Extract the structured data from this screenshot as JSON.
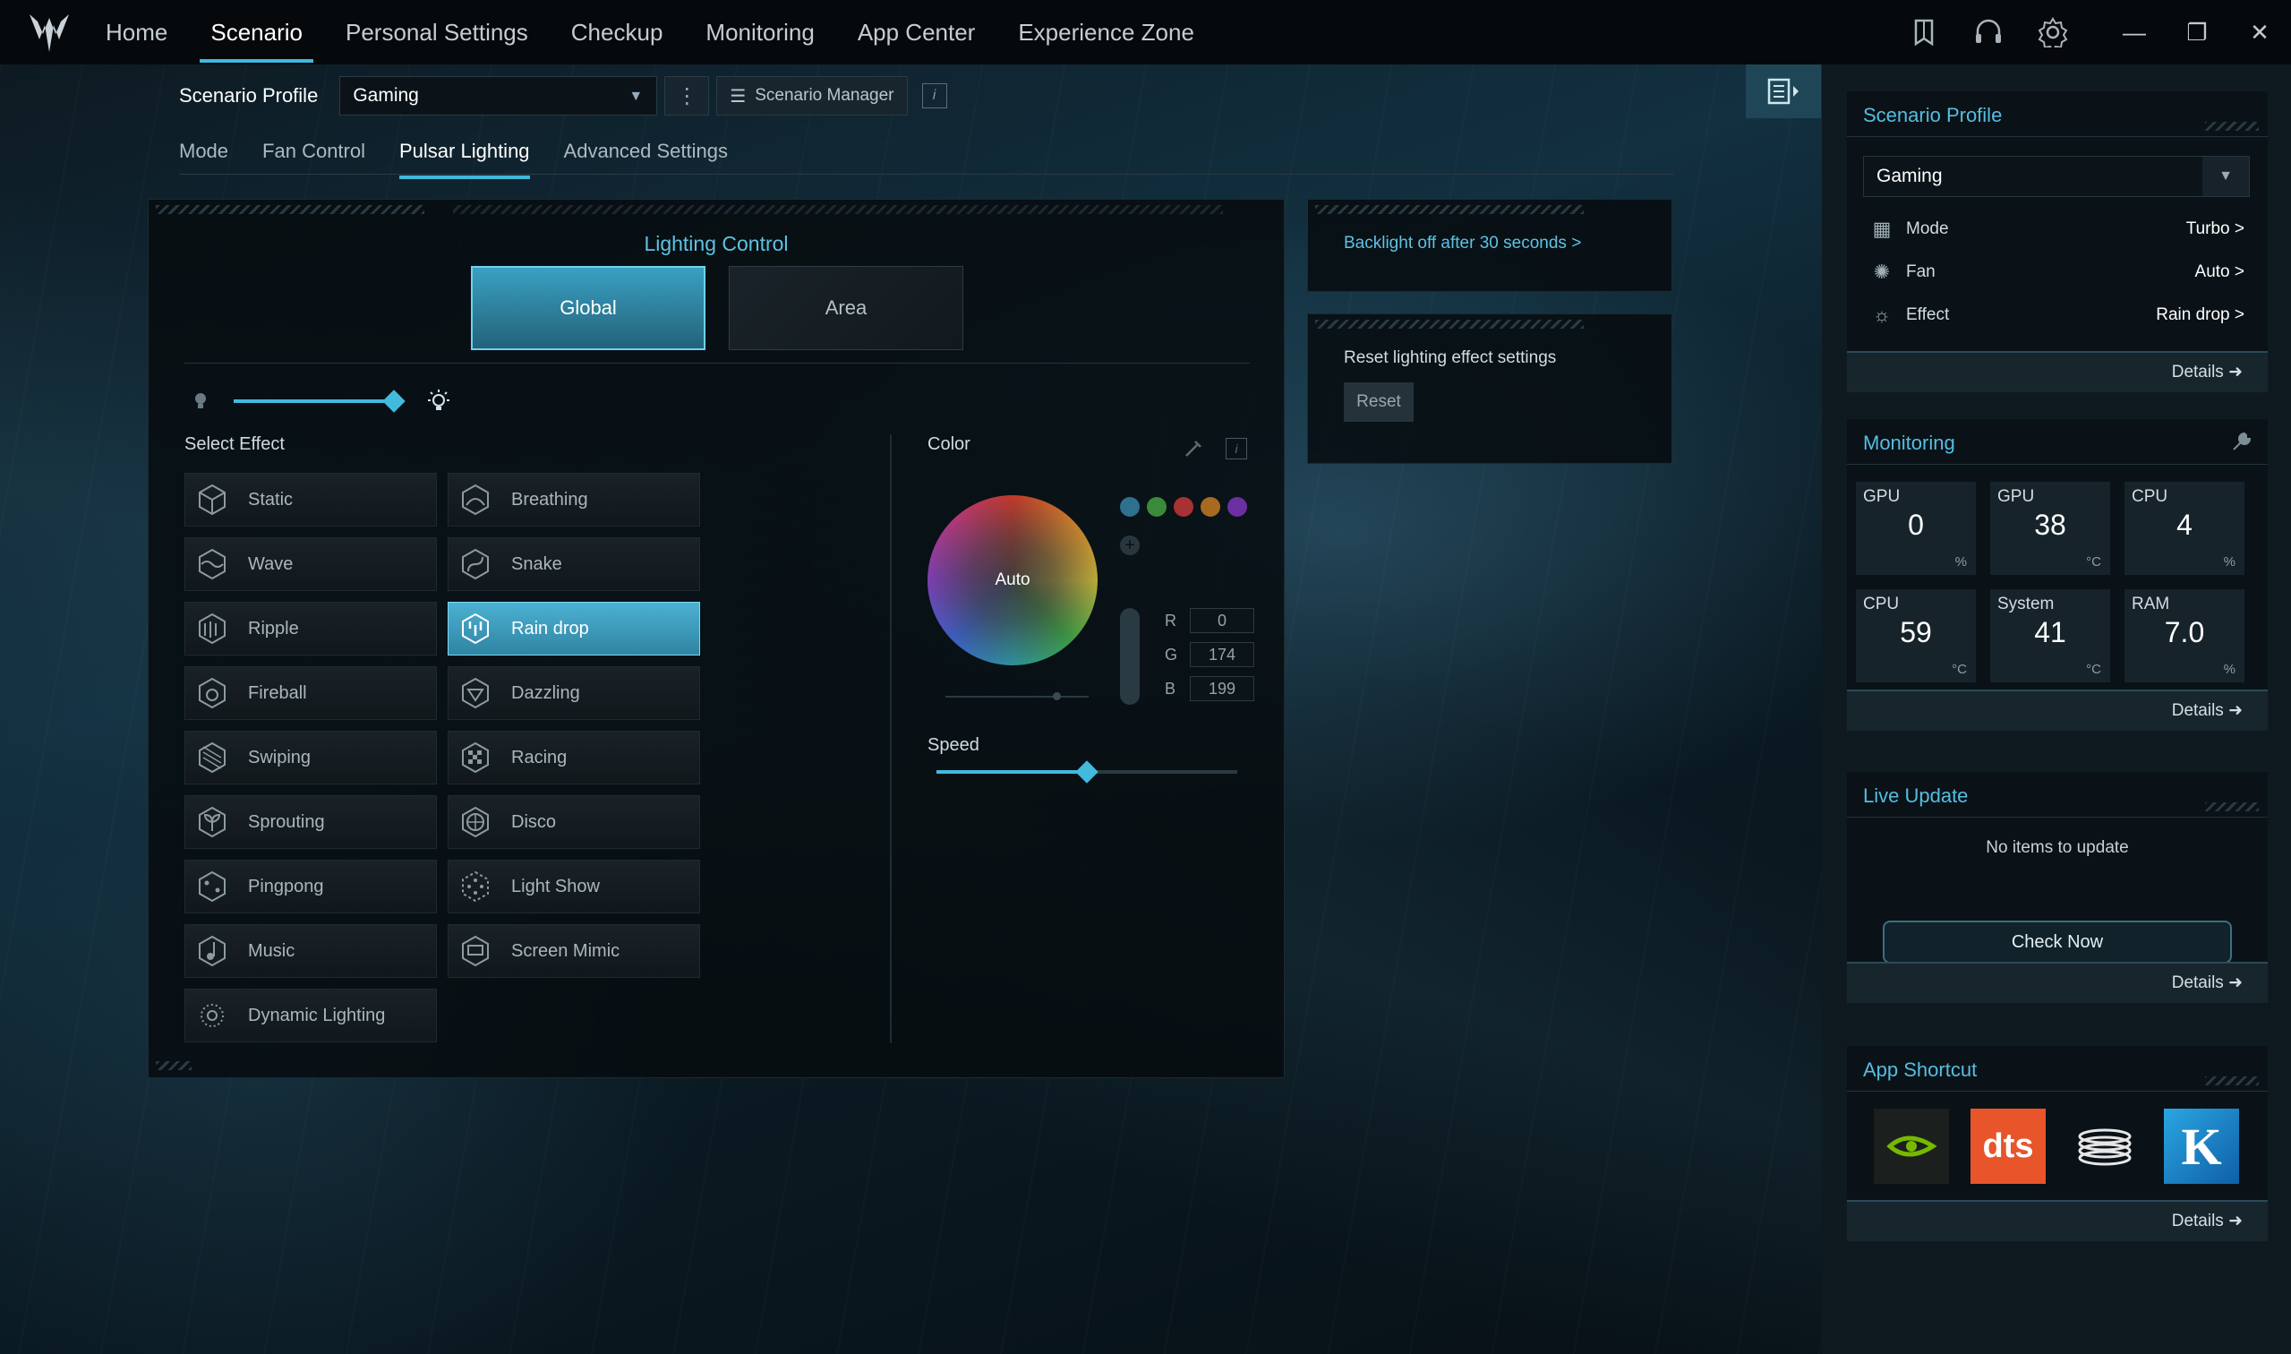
{
  "nav": {
    "items": [
      "Home",
      "Scenario",
      "Personal Settings",
      "Checkup",
      "Monitoring",
      "App Center",
      "Experience Zone"
    ],
    "active_index": 1
  },
  "toolbar_icons": [
    "bookmark-icon",
    "headset-icon",
    "gear-icon"
  ],
  "window_controls": [
    "—",
    "❐",
    "✕"
  ],
  "profile": {
    "label": "Scenario Profile",
    "value": "Gaming",
    "manager_label": "Scenario Manager",
    "info": "i"
  },
  "tabs": [
    "Mode",
    "Fan Control",
    "Pulsar Lighting",
    "Advanced Settings"
  ],
  "active_tab": 2,
  "lighting": {
    "title": "Lighting Control",
    "global_label": "Global",
    "area_label": "Area",
    "brightness_fraction": 0.97,
    "select_effect_label": "Select Effect",
    "effects": [
      [
        "Static",
        "Breathing"
      ],
      [
        "Wave",
        "Snake"
      ],
      [
        "Ripple",
        "Rain drop"
      ],
      [
        "Fireball",
        "Dazzling"
      ],
      [
        "Swiping",
        "Racing"
      ],
      [
        "Sprouting",
        "Disco"
      ],
      [
        "Pingpong",
        "Light Show"
      ],
      [
        "Music",
        "Screen Mimic"
      ],
      [
        "Dynamic Lighting"
      ]
    ],
    "active_effect": "Rain drop",
    "color_label": "Color",
    "color_mode": "Auto",
    "swatches": [
      "#2f6f8f",
      "#3a8a3a",
      "#a83232",
      "#a86a1f",
      "#6a2fa0"
    ],
    "rgb": {
      "r_label": "R",
      "r": "0",
      "g_label": "G",
      "g": "174",
      "b_label": "B",
      "b": "199"
    },
    "speed_label": "Speed",
    "speed_fraction": 0.5
  },
  "backlight": {
    "link": "Backlight off after 30 seconds >"
  },
  "reset_card": {
    "text": "Reset lighting effect settings",
    "button": "Reset"
  },
  "sidebar": {
    "scenario": {
      "title": "Scenario Profile",
      "value": "Gaming",
      "rows": [
        {
          "label": "Mode",
          "value": "Turbo >"
        },
        {
          "label": "Fan",
          "value": "Auto >"
        },
        {
          "label": "Effect",
          "value": "Rain drop >"
        }
      ],
      "details": "Details ➜"
    },
    "monitoring": {
      "title": "Monitoring",
      "cells": [
        {
          "label": "GPU",
          "value": "0",
          "unit": "%"
        },
        {
          "label": "GPU",
          "value": "38",
          "unit": "°C"
        },
        {
          "label": "CPU",
          "value": "4",
          "unit": "%"
        },
        {
          "label": "CPU",
          "value": "59",
          "unit": "°C"
        },
        {
          "label": "System",
          "value": "41",
          "unit": "°C"
        },
        {
          "label": "RAM",
          "value": "7.0",
          "unit": "%"
        }
      ],
      "details": "Details ➜"
    },
    "live_update": {
      "title": "Live Update",
      "message": "No items to update",
      "button": "Check Now",
      "details": "Details ➜"
    },
    "app_shortcut": {
      "title": "App Shortcut",
      "apps": [
        "nvidia-icon",
        "dts-icon",
        "rings-icon",
        "k-icon"
      ],
      "dts_text": "dts",
      "k_text": "K",
      "details": "Details ➜"
    }
  },
  "colors": {
    "accent": "#43b9de",
    "accent_text": "#5fc2e3",
    "dts_orange": "#e8552b",
    "nvidia_green": "#76b900"
  }
}
